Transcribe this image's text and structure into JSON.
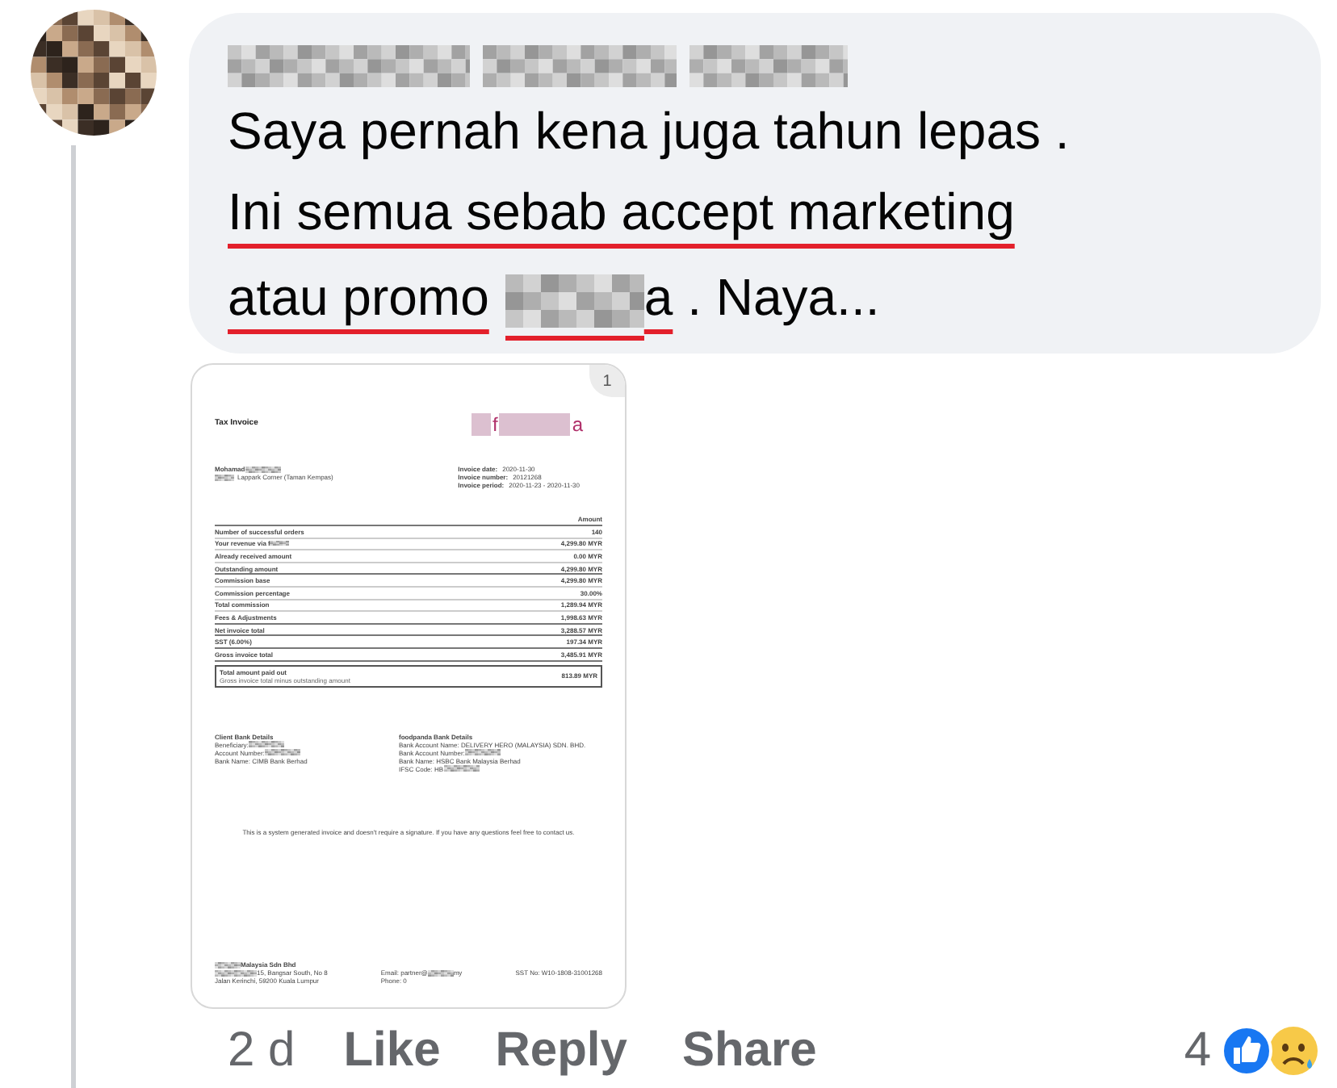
{
  "comment": {
    "text_lines": [
      {
        "text": "Saya pernah kena juga tahun lepas .",
        "underlined": false
      },
      {
        "text": "Ini semua sebab accept marketing",
        "underlined": true
      },
      {
        "text": "atau promo",
        "underlined": true
      }
    ],
    "text_after_redaction": "a",
    "text_tail": " . Naya..."
  },
  "invoice": {
    "page": "1",
    "title": "Tax Invoice",
    "logo_letters": [
      "f",
      "a"
    ],
    "customer_name": "Mohamad",
    "customer_address": "Lappark Corner (Taman Kempas)",
    "meta": [
      {
        "label": "Invoice date:",
        "value": "2020-11-30"
      },
      {
        "label": "Invoice number:",
        "value": "20121268"
      },
      {
        "label": "Invoice period:",
        "value": "2020-11-23 - 2020-11-30"
      }
    ],
    "amount_header": "Amount",
    "rows": [
      {
        "label": "Number of successful orders",
        "value": "140",
        "bold_rule": false,
        "redacted": false
      },
      {
        "label": "Your revenue via f",
        "value": "4,299.80 MYR",
        "bold_rule": false,
        "redacted": true
      },
      {
        "label": "Already received amount",
        "value": "0.00 MYR",
        "bold_rule": false,
        "redacted": false
      },
      {
        "label": "Outstanding amount",
        "value": "4,299.80 MYR",
        "bold_rule": true,
        "redacted": false
      },
      {
        "label": "Commission base",
        "value": "4,299.80 MYR",
        "bold_rule": false,
        "redacted": false
      },
      {
        "label": "Commission percentage",
        "value": "30.00%",
        "bold_rule": false,
        "redacted": false
      },
      {
        "label": "Total commission",
        "value": "1,289.94 MYR",
        "bold_rule": false,
        "redacted": false
      },
      {
        "label": "Fees & Adjustments",
        "value": "1,998.63 MYR",
        "bold_rule": true,
        "redacted": false
      },
      {
        "label": "Net invoice total",
        "value": "3,288.57 MYR",
        "bold_rule": true,
        "redacted": false
      },
      {
        "label": "SST (6.00%)",
        "value": "197.34 MYR",
        "bold_rule": true,
        "redacted": false
      },
      {
        "label": "Gross invoice total",
        "value": "3,485.91 MYR",
        "bold_rule": true,
        "redacted": false
      }
    ],
    "total": {
      "label": "Total amount paid out",
      "sublabel": "Gross invoice total minus outstanding amount",
      "value": "813.89 MYR"
    },
    "client_bank": {
      "title": "Client Bank Details",
      "lines": [
        {
          "text": "Beneficiary:",
          "redacted": true
        },
        {
          "text": "Account Number:",
          "redacted": true
        },
        {
          "text": "Bank Name: CIMB Bank Berhad",
          "redacted": false
        }
      ]
    },
    "vendor_bank": {
      "title": "foodpanda Bank Details",
      "lines": [
        {
          "text": "Bank Account Name: DELIVERY HERO (MALAYSIA) SDN. BHD.",
          "redacted": false
        },
        {
          "text": "Bank Account Number:",
          "redacted": true
        },
        {
          "text": "Bank Name: HSBC Bank Malaysia Berhad",
          "redacted": false
        },
        {
          "text": "IFSC Code: HB",
          "redacted": true
        }
      ]
    },
    "note": "This is a system generated invoice and doesn't require a signature. If you have any questions feel free to contact us.",
    "footer_company": "Malaysia Sdn Bhd",
    "footer_address": [
      "15, Bangsar South, No 8",
      "Jalan Kerinchi, 59200 Kuala Lumpur"
    ],
    "footer_email": "Email: partner@",
    "footer_email_end": "my",
    "footer_phone": "Phone: 0",
    "footer_sst": "SST No: W10-1808-31001268"
  },
  "actions": {
    "time": "2 d",
    "buttons": [
      "Like",
      "Reply",
      "Share"
    ],
    "reaction_count": "4"
  }
}
